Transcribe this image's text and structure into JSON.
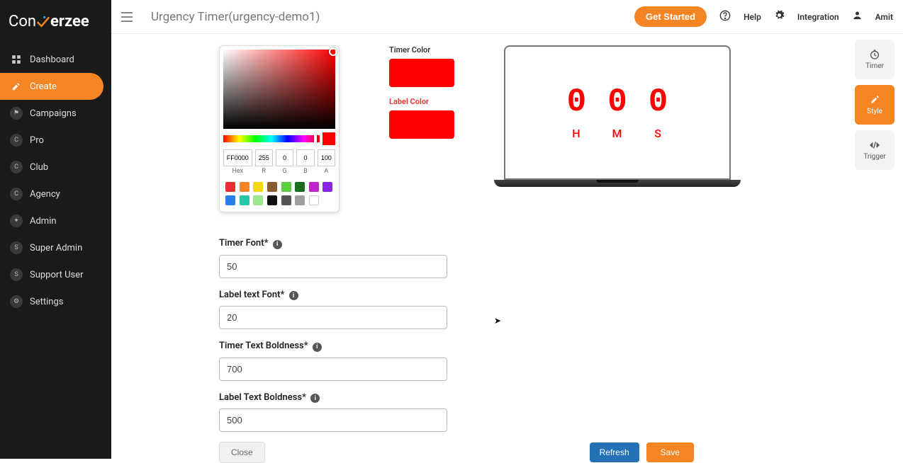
{
  "brand": {
    "part1": "Con",
    "part2": "erzee"
  },
  "sidebar": {
    "items": [
      {
        "label": "Dashboard"
      },
      {
        "label": "Create"
      },
      {
        "label": "Campaigns"
      },
      {
        "label": "Pro"
      },
      {
        "label": "Club"
      },
      {
        "label": "Agency"
      },
      {
        "label": "Admin"
      },
      {
        "label": "Super Admin"
      },
      {
        "label": "Support User"
      },
      {
        "label": "Settings"
      }
    ]
  },
  "header": {
    "title": "Urgency Timer(urgency-demo1)",
    "getStarted": "Get Started",
    "help": "Help",
    "integration": "Integration",
    "user": "Amit"
  },
  "vtabs": {
    "timer": "Timer",
    "style": "Style",
    "trigger": "Trigger"
  },
  "colorPicker": {
    "hex": "FF0000",
    "r": "255",
    "g": "0",
    "b": "0",
    "a": "100",
    "labels": {
      "hex": "Hex",
      "r": "R",
      "g": "G",
      "b": "B",
      "a": "A"
    },
    "swatches": [
      "#ef2f2f",
      "#f48424",
      "#f5d90a",
      "#8a5c2e",
      "#5ccf41",
      "#176e1f",
      "#c224c7",
      "#8a24e6",
      "#2a7dea",
      "#24c7a5",
      "#9ee68e",
      "#111111",
      "#555555",
      "#9e9e9e",
      "#ffffff"
    ]
  },
  "colorFields": {
    "timerLabel": "Timer Color",
    "labelLabel": "Label Color",
    "timerColor": "#ff0000",
    "labelColor": "#ff0000"
  },
  "preview": {
    "items": [
      {
        "value": "0",
        "label": "H"
      },
      {
        "value": "0",
        "label": "M"
      },
      {
        "value": "0",
        "label": "S"
      }
    ]
  },
  "form": {
    "timerFont": {
      "label": "Timer Font*",
      "value": "50"
    },
    "labelFont": {
      "label": "Label text Font*",
      "value": "20"
    },
    "timerBold": {
      "label": "Timer Text Boldness*",
      "value": "700"
    },
    "labelBold": {
      "label": "Label Text Boldness*",
      "value": "500"
    }
  },
  "footer": {
    "close": "Close",
    "refresh": "Refresh",
    "save": "Save"
  }
}
